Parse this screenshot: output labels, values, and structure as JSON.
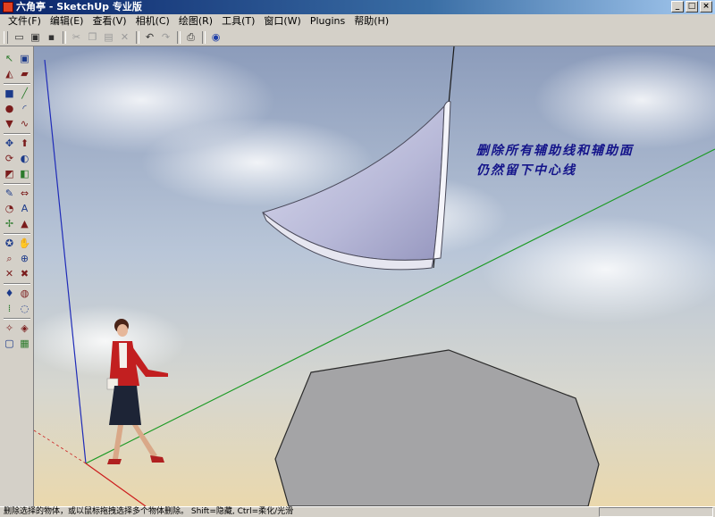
{
  "window": {
    "title": "六角亭 - SketchUp 专业版",
    "controls": [
      "_",
      "□",
      "×"
    ]
  },
  "menu": [
    "文件(F)",
    "编辑(E)",
    "查看(V)",
    "相机(C)",
    "绘图(R)",
    "工具(T)",
    "窗口(W)",
    "Plugins",
    "帮助(H)"
  ],
  "toolbar": {
    "items": [
      {
        "name": "new-icon",
        "glyph": "▭"
      },
      {
        "name": "open-icon",
        "glyph": "▣"
      },
      {
        "name": "save-icon",
        "glyph": "▪"
      },
      {
        "name": "cut-icon",
        "glyph": "✂"
      },
      {
        "name": "copy-icon",
        "glyph": "❐"
      },
      {
        "name": "paste-icon",
        "glyph": "▤"
      },
      {
        "name": "erase-icon",
        "glyph": "✕"
      },
      {
        "name": "undo-icon",
        "glyph": "↶"
      },
      {
        "name": "redo-icon",
        "glyph": "↷"
      },
      {
        "name": "print-icon",
        "glyph": "⎙"
      },
      {
        "name": "model-info-icon",
        "glyph": "◉"
      }
    ]
  },
  "tools_left": [
    {
      "name": "select-icon",
      "glyph": "↖"
    },
    {
      "name": "make-component-icon",
      "glyph": "▣"
    },
    {
      "name": "paint-bucket-icon",
      "glyph": "◭"
    },
    {
      "name": "eraser-icon",
      "glyph": "▰"
    },
    {
      "name": "rectangle-icon",
      "glyph": "■"
    },
    {
      "name": "line-icon",
      "glyph": "╱"
    },
    {
      "name": "circle-icon",
      "glyph": "●"
    },
    {
      "name": "arc-icon",
      "glyph": "◜"
    },
    {
      "name": "polygon-icon",
      "glyph": "▼"
    },
    {
      "name": "freehand-icon",
      "glyph": "∿"
    },
    {
      "name": "move-icon",
      "glyph": "✥"
    },
    {
      "name": "push-pull-icon",
      "glyph": "⬆"
    },
    {
      "name": "rotate-icon",
      "glyph": "⟳"
    },
    {
      "name": "follow-me-icon",
      "glyph": "◐"
    },
    {
      "name": "scale-icon",
      "glyph": "◩"
    },
    {
      "name": "offset-icon",
      "glyph": "◧"
    },
    {
      "name": "tape-measure-icon",
      "glyph": "✎"
    },
    {
      "name": "dimension-icon",
      "glyph": "⇔"
    },
    {
      "name": "protractor-icon",
      "glyph": "◔"
    },
    {
      "name": "text-icon",
      "glyph": "A"
    },
    {
      "name": "axes-icon",
      "glyph": "✢"
    },
    {
      "name": "3d-text-icon",
      "glyph": "▲"
    },
    {
      "name": "orbit-icon",
      "glyph": "✪"
    },
    {
      "name": "pan-icon",
      "glyph": "✋"
    },
    {
      "name": "zoom-icon",
      "glyph": "⌕"
    },
    {
      "name": "zoom-window-icon",
      "glyph": "⊕"
    },
    {
      "name": "previous-view-icon",
      "glyph": "✕"
    },
    {
      "name": "zoom-extents-icon",
      "glyph": "✖"
    },
    {
      "name": "position-camera-icon",
      "glyph": "♦"
    },
    {
      "name": "walk-icon",
      "glyph": "◍"
    },
    {
      "name": "look-around-icon",
      "glyph": "⁞"
    },
    {
      "name": "section-plane-icon",
      "glyph": "◌"
    },
    {
      "name": "sandbox-icon",
      "glyph": "✧"
    },
    {
      "name": "terrain-icon",
      "glyph": "◈"
    },
    {
      "name": "smoove-icon",
      "glyph": "▢"
    },
    {
      "name": "stamp-icon",
      "glyph": "▦"
    }
  ],
  "viewport": {
    "annotation_lines": [
      "删除所有辅助线和辅助面",
      "仍然留下中心线"
    ],
    "colors": {
      "sky_top": "#9aa9c4",
      "sky_bottom": "#e8d6ae",
      "shell_face": "#b9bad9",
      "shell_edge": "#ffffff",
      "hexagon_fill": "#a4a4a6",
      "blue_axis": "#1f2bb8",
      "green_axis": "#1a9a22",
      "red_axis": "#cc1c1c",
      "annotation": "#14148a"
    }
  },
  "status": {
    "message": "删除选择的物体，或以鼠标拖拽选择多个物体删除。 Shift=隐藏, Ctrl=柔化/光滑"
  }
}
